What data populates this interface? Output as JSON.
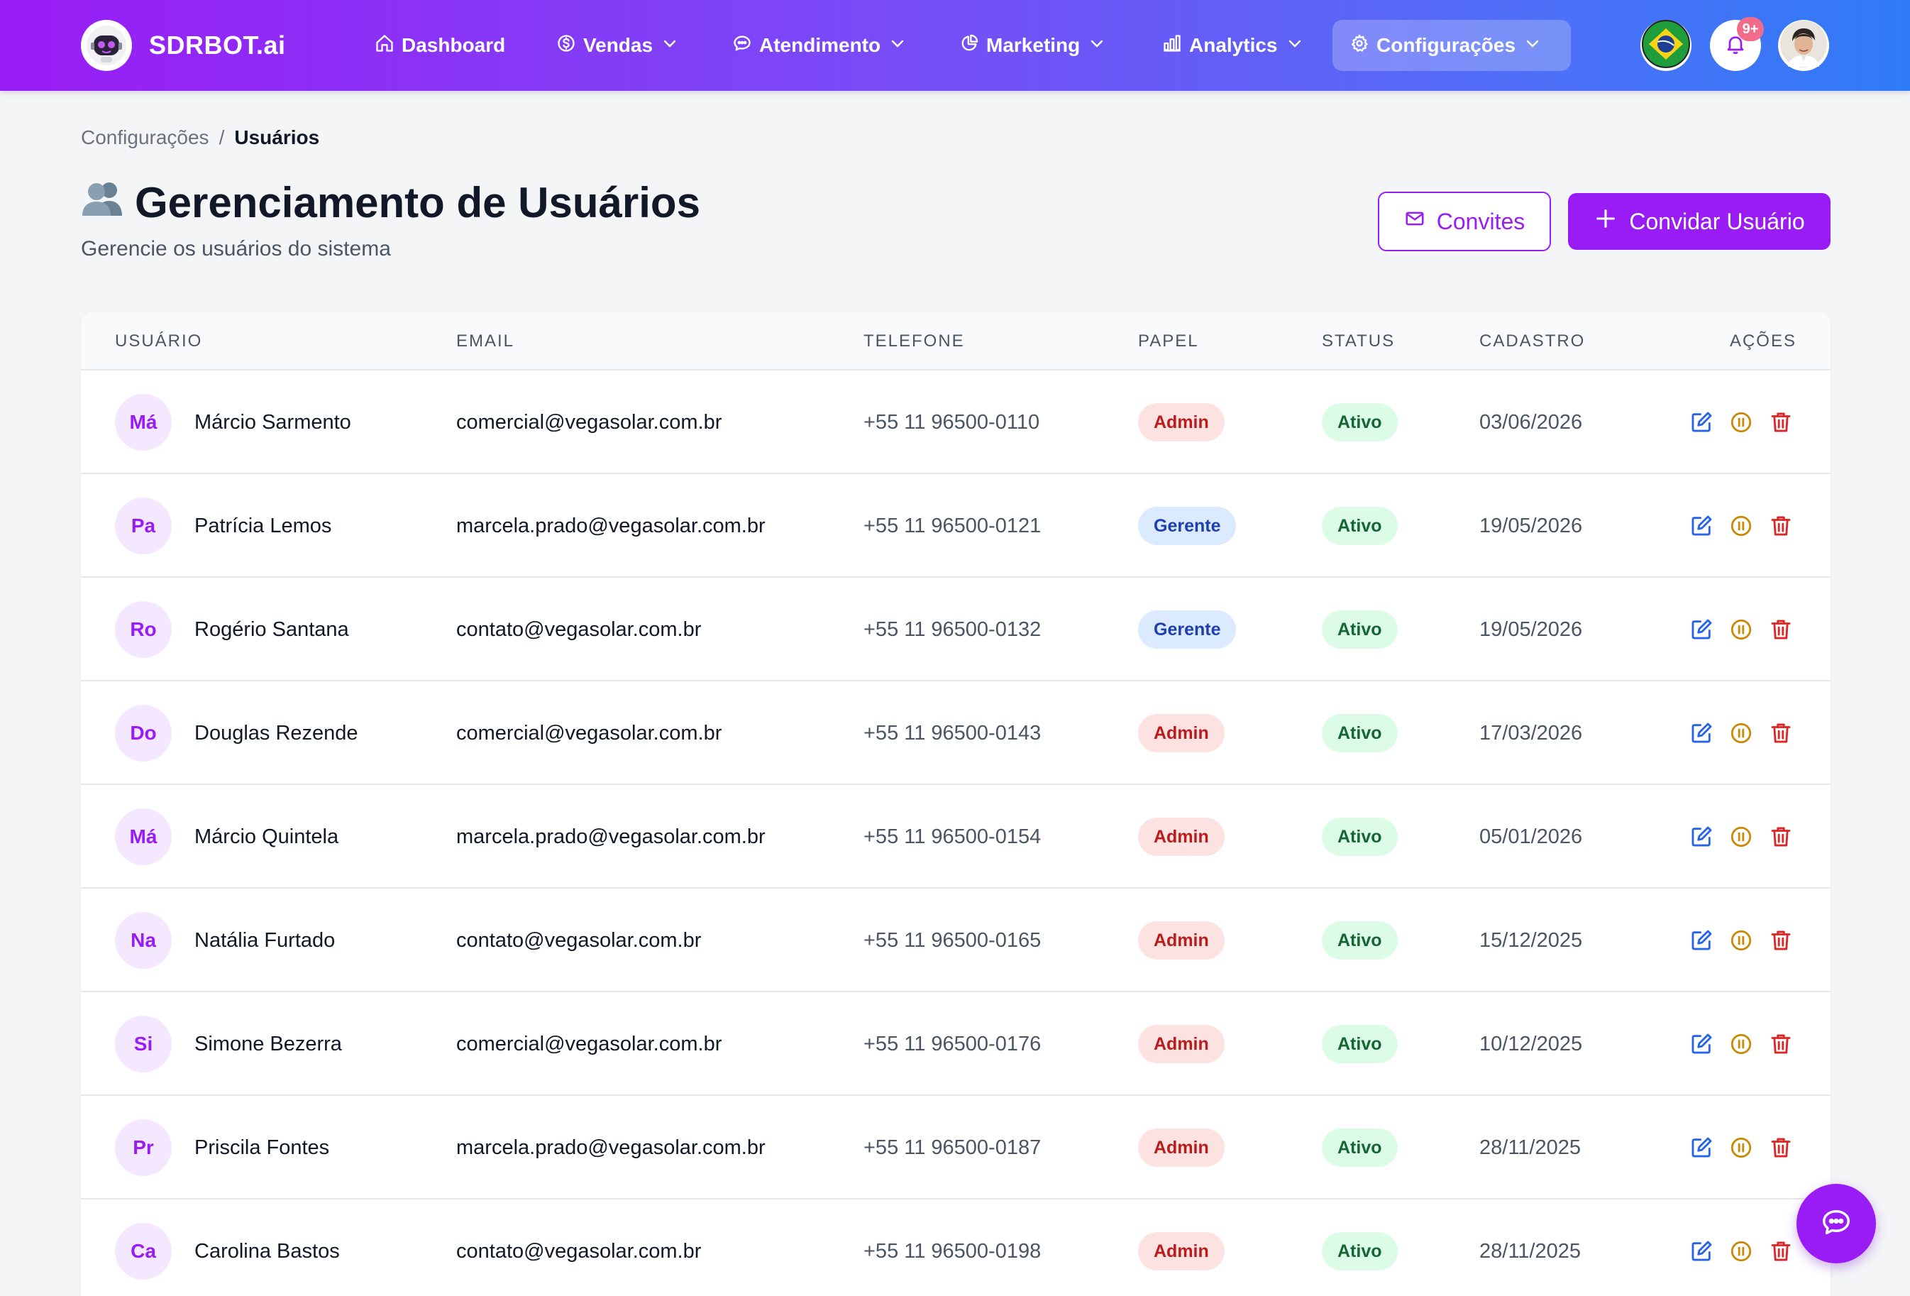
{
  "app": {
    "brand": "SDRBOT.ai",
    "colors": {
      "accent": "#9a1cf5",
      "gradient_end": "#2f7bf6",
      "admin": "#b91c1c",
      "gerente": "#1e40af",
      "ativo": "#166534"
    }
  },
  "nav": {
    "items": [
      {
        "label": "Dashboard",
        "icon": "home-icon"
      },
      {
        "label": "Vendas",
        "icon": "dollar-icon"
      },
      {
        "label": "Atendimento",
        "icon": "chat-icon"
      },
      {
        "label": "Marketing",
        "icon": "pie-icon"
      },
      {
        "label": "Analytics",
        "icon": "bar-chart-icon"
      },
      {
        "label": "Configurações",
        "icon": "gear-icon",
        "active": true
      }
    ],
    "notifications": "9+"
  },
  "breadcrumb": {
    "parent": "Configurações",
    "separator": "/",
    "current": "Usuários"
  },
  "page": {
    "title": "Gerenciamento de Usuários",
    "subtitle": "Gerencie os usuários do sistema",
    "invites_label": "Convites",
    "invite_user_label": "Convidar Usuário"
  },
  "table": {
    "headers": {
      "user": "USUÁRIO",
      "email": "EMAIL",
      "phone": "TELEFONE",
      "role": "PAPEL",
      "status": "STATUS",
      "created": "CADASTRO",
      "actions": "AÇÕES"
    },
    "rows": [
      {
        "initials": "Má",
        "name": "Márcio Sarmento",
        "email": "comercial@vegasolar.com.br",
        "phone": "+55 11 96500-0110",
        "role": "Admin",
        "status": "Ativo",
        "created": "03/06/2026"
      },
      {
        "initials": "Pa",
        "name": "Patrícia Lemos",
        "email": "marcela.prado@vegasolar.com.br",
        "phone": "+55 11 96500-0121",
        "role": "Gerente",
        "status": "Ativo",
        "created": "19/05/2026"
      },
      {
        "initials": "Ro",
        "name": "Rogério Santana",
        "email": "contato@vegasolar.com.br",
        "phone": "+55 11 96500-0132",
        "role": "Gerente",
        "status": "Ativo",
        "created": "19/05/2026"
      },
      {
        "initials": "Do",
        "name": "Douglas Rezende",
        "email": "comercial@vegasolar.com.br",
        "phone": "+55 11 96500-0143",
        "role": "Admin",
        "status": "Ativo",
        "created": "17/03/2026"
      },
      {
        "initials": "Má",
        "name": "Márcio Quintela",
        "email": "marcela.prado@vegasolar.com.br",
        "phone": "+55 11 96500-0154",
        "role": "Admin",
        "status": "Ativo",
        "created": "05/01/2026"
      },
      {
        "initials": "Na",
        "name": "Natália Furtado",
        "email": "contato@vegasolar.com.br",
        "phone": "+55 11 96500-0165",
        "role": "Admin",
        "status": "Ativo",
        "created": "15/12/2025"
      },
      {
        "initials": "Si",
        "name": "Simone Bezerra",
        "email": "comercial@vegasolar.com.br",
        "phone": "+55 11 96500-0176",
        "role": "Admin",
        "status": "Ativo",
        "created": "10/12/2025"
      },
      {
        "initials": "Pr",
        "name": "Priscila Fontes",
        "email": "marcela.prado@vegasolar.com.br",
        "phone": "+55 11 96500-0187",
        "role": "Admin",
        "status": "Ativo",
        "created": "28/11/2025"
      },
      {
        "initials": "Ca",
        "name": "Carolina Bastos",
        "email": "contato@vegasolar.com.br",
        "phone": "+55 11 96500-0198",
        "role": "Admin",
        "status": "Ativo",
        "created": "28/11/2025"
      }
    ]
  }
}
